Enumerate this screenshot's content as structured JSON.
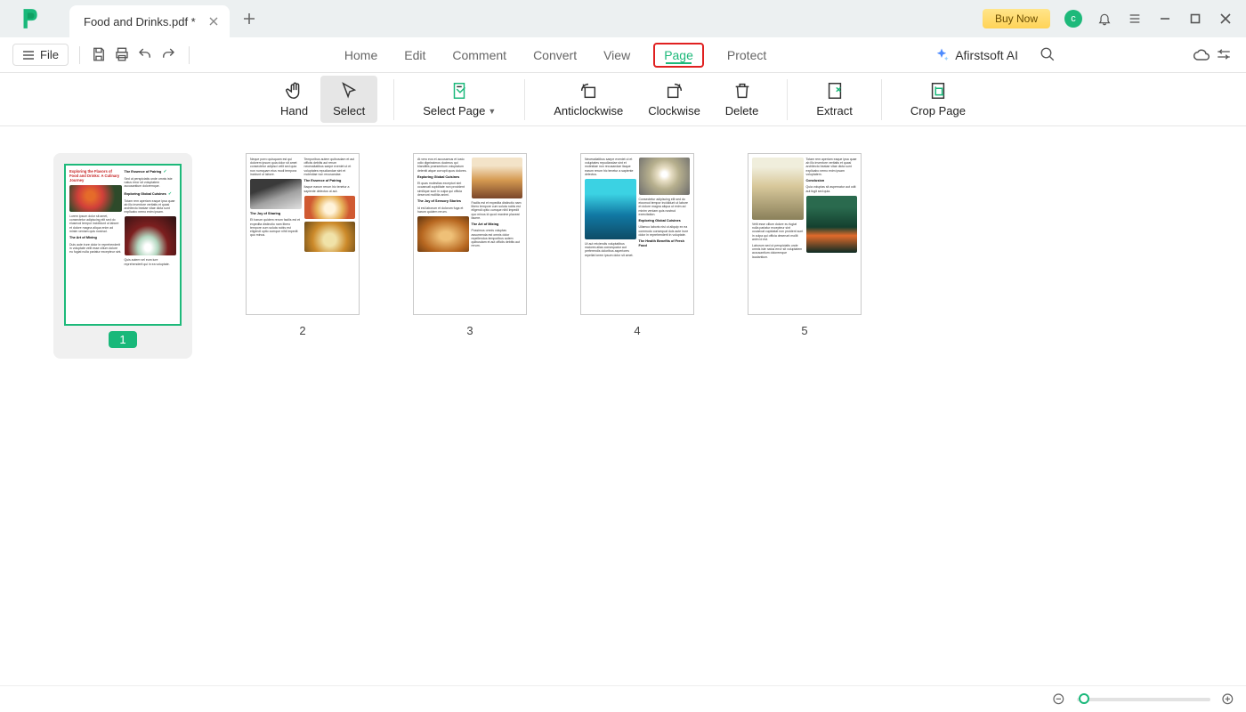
{
  "titlebar": {
    "tab_title": "Food and Drinks.pdf *",
    "buy_now": "Buy Now",
    "avatar_letter": "c"
  },
  "menubar": {
    "file": "File",
    "items": [
      "Home",
      "Edit",
      "Comment",
      "Convert",
      "View",
      "Page",
      "Protect"
    ],
    "ai": "Afirstsoft AI"
  },
  "toolbar": {
    "hand": "Hand",
    "select": "Select",
    "select_page": "Select Page",
    "anticlockwise": "Anticlockwise",
    "clockwise": "Clockwise",
    "delete": "Delete",
    "extract": "Extract",
    "crop": "Crop Page"
  },
  "pages": {
    "selected": 1,
    "numbers": [
      "1",
      "2",
      "3",
      "4",
      "5"
    ],
    "doc_title": "Exploring the Flavors of Food and Drinks: A Culinary Journey"
  }
}
